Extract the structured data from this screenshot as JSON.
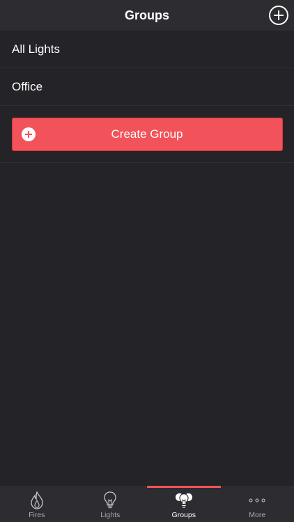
{
  "header": {
    "title": "Groups"
  },
  "groups": [
    {
      "label": "All Lights"
    },
    {
      "label": "Office"
    }
  ],
  "create_button": {
    "label": "Create Group"
  },
  "tabs": [
    {
      "label": "Fires",
      "icon": "flame-icon",
      "active": false
    },
    {
      "label": "Lights",
      "icon": "lightbulb-icon",
      "active": false
    },
    {
      "label": "Groups",
      "icon": "bulb-group-icon",
      "active": true
    },
    {
      "label": "More",
      "icon": "more-dots-icon",
      "active": false
    }
  ],
  "colors": {
    "accent": "#f25259",
    "background": "#242428",
    "bar": "#2c2c31"
  }
}
